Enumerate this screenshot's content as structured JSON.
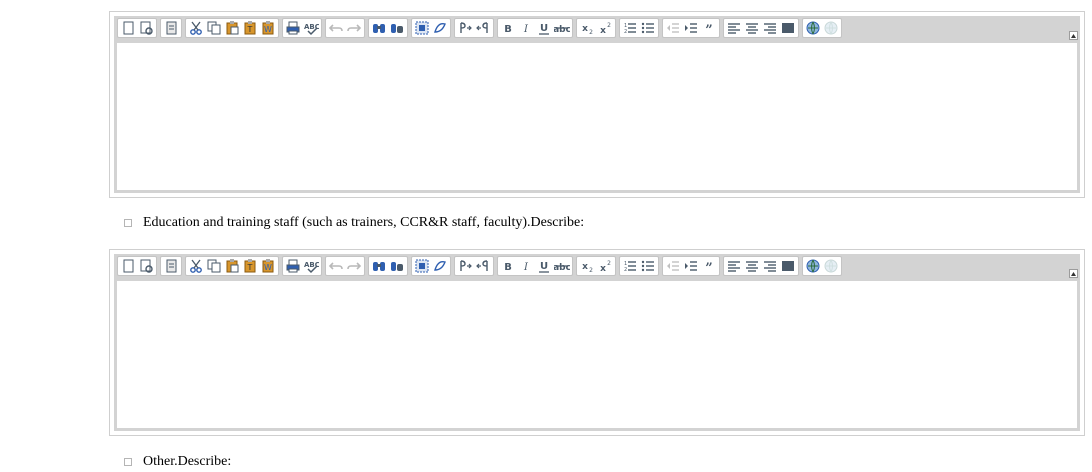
{
  "accent_colors": {
    "toolbar_bg": "#d3d3d3",
    "icon_dark": "#4a5a6a",
    "icon_blue": "#2f5fb0",
    "icon_orange": "#d8962c"
  },
  "toolbar_groups": [
    [
      {
        "name": "new-page-icon",
        "title": ""
      },
      {
        "name": "preview-icon",
        "title": ""
      }
    ],
    [
      {
        "name": "templates-icon",
        "title": ""
      }
    ],
    [
      {
        "name": "cut-icon",
        "title": ""
      },
      {
        "name": "copy-icon",
        "title": ""
      },
      {
        "name": "paste-icon",
        "title": ""
      },
      {
        "name": "paste-text-icon",
        "title": ""
      },
      {
        "name": "paste-word-icon",
        "title": ""
      }
    ],
    [
      {
        "name": "print-icon",
        "title": ""
      },
      {
        "name": "spellcheck-icon",
        "title": ""
      }
    ],
    [
      {
        "name": "undo-icon",
        "title": "",
        "disabled": true
      },
      {
        "name": "redo-icon",
        "title": "",
        "disabled": true
      }
    ],
    [
      {
        "name": "find-icon",
        "title": ""
      },
      {
        "name": "replace-icon",
        "title": ""
      }
    ],
    [
      {
        "name": "select-all-icon",
        "title": ""
      },
      {
        "name": "remove-format-icon",
        "title": ""
      }
    ],
    [
      {
        "name": "ltr-icon",
        "title": ""
      },
      {
        "name": "rtl-icon",
        "title": ""
      }
    ],
    [
      {
        "name": "bold-icon",
        "title": ""
      },
      {
        "name": "italic-icon",
        "title": ""
      },
      {
        "name": "underline-icon",
        "title": ""
      },
      {
        "name": "strikethrough-icon",
        "title": ""
      }
    ],
    [
      {
        "name": "subscript-icon",
        "title": ""
      },
      {
        "name": "superscript-icon",
        "title": ""
      }
    ],
    [
      {
        "name": "numbered-list-icon",
        "title": ""
      },
      {
        "name": "bulleted-list-icon",
        "title": ""
      }
    ],
    [
      {
        "name": "outdent-icon",
        "title": "",
        "disabled": true
      },
      {
        "name": "indent-icon",
        "title": ""
      },
      {
        "name": "blockquote-icon",
        "title": ""
      }
    ],
    [
      {
        "name": "align-left-icon",
        "title": ""
      },
      {
        "name": "align-center-icon",
        "title": ""
      },
      {
        "name": "align-right-icon",
        "title": ""
      },
      {
        "name": "justify-icon",
        "title": ""
      }
    ],
    [
      {
        "name": "link-icon",
        "title": ""
      },
      {
        "name": "unlink-icon",
        "title": "",
        "disabled": true
      }
    ]
  ],
  "checkboxes": {
    "education": {
      "label": "Education and training staff (such as trainers, CCR&R staff, faculty).Describe:",
      "checked": false
    },
    "other": {
      "label": "Other.Describe:",
      "checked": false
    }
  }
}
